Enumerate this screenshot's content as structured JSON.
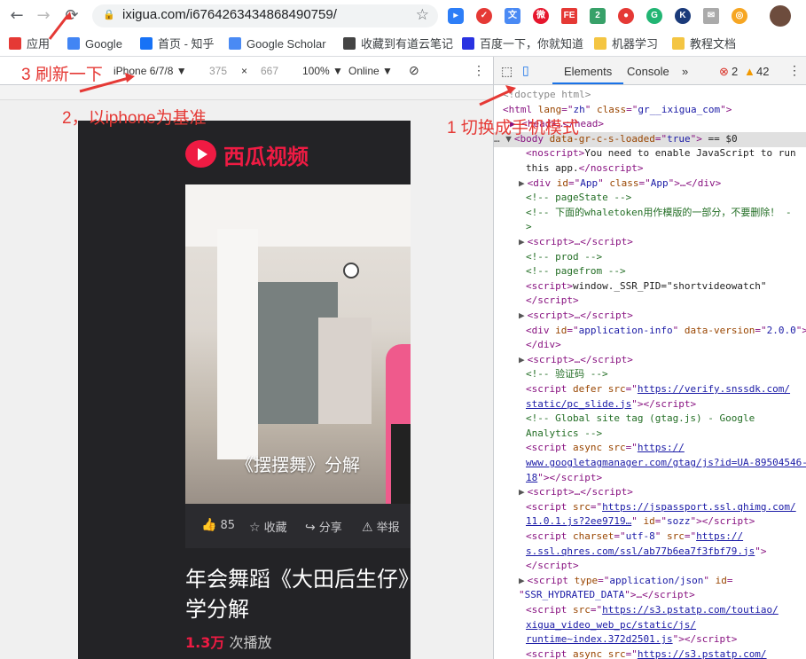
{
  "browser": {
    "url": "ixigua.com/i6764263434868490759/",
    "lock_icon": "lock-icon",
    "star_icon": "star-icon"
  },
  "bookmarks": [
    {
      "label": "应用",
      "color": "#e53935"
    },
    {
      "label": "Google",
      "color": "#4285f4"
    },
    {
      "label": "首页 - 知乎",
      "color": "#1772f6"
    },
    {
      "label": "Google Scholar",
      "color": "#4a8af4"
    },
    {
      "label": "收藏到有道云笔记",
      "color": "#444"
    },
    {
      "label": "百度一下，你就知道",
      "color": "#2932e1"
    },
    {
      "label": "机器学习",
      "color": "#f4c542"
    },
    {
      "label": "教程文档",
      "color": "#f4c542"
    }
  ],
  "devbar": {
    "device": "iPhone 6/7/8 ▼",
    "width": "375",
    "times": "×",
    "height": "667",
    "zoom": "100% ▼",
    "network": "Online ▼"
  },
  "devtools": {
    "tab_elements": "Elements",
    "tab_console": "Console",
    "more": "»",
    "errors": "2",
    "warnings": "42"
  },
  "page": {
    "logo_text": "西瓜视频",
    "video_caption": "《摆摆舞》分解",
    "like_count": "85",
    "collect": "收藏",
    "share": "分享",
    "report": "举报",
    "title": "年会舞蹈《大田后生仔》学分解",
    "views_number": "1.3万",
    "views_suffix": "次播放"
  },
  "annotations": {
    "step1": "1 切换成手机模式",
    "step2": "2，以iphone为基准",
    "step3": "3 刷新一下"
  },
  "dom_lines": [
    {
      "ind": 10,
      "html": "&lt;!doctype html&gt;",
      "cls": "gray"
    },
    {
      "ind": 10,
      "html": "&lt;html <span class='a'>lang</span>=\"<span class='v'>zh</span>\" <span class='a'>class</span>=\"<span class='v'>gr__ixigua_com</span>\"&gt;"
    },
    {
      "ind": 18,
      "html": "▶ &lt;head&gt;…&lt;/head&gt;"
    },
    {
      "ind": 0,
      "html": "<span class='tri'>… ▼</span>&lt;body <span class='a'>data-gr-c-s-loaded</span>=\"<span class='v'>true</span>\"&gt; <span class='t'>== $0</span>"
    },
    {
      "ind": 36,
      "html": "&lt;noscript&gt;<span class='t'>You need to enable JavaScript to run</span>"
    },
    {
      "ind": 36,
      "html": "<span class='t'>this app.</span>&lt;/noscript&gt;"
    },
    {
      "ind": 28,
      "html": "<span class='tri'>▶</span>&lt;div <span class='a'>id</span>=\"<span class='v'>App</span>\" <span class='a'>class</span>=\"<span class='v'>App</span>\"&gt;…&lt;/div&gt;"
    },
    {
      "ind": 36,
      "html": "<span class='c'>&lt;!-- pageState --&gt;</span>"
    },
    {
      "ind": 36,
      "html": "<span class='c'>&lt;!-- 下面的whaletoken用作模版的一部分，不要删除！ -</span>"
    },
    {
      "ind": 36,
      "html": "<span class='c'>&gt;</span>"
    },
    {
      "ind": 28,
      "html": "<span class='tri'>▶</span>&lt;script&gt;…&lt;/script&gt;"
    },
    {
      "ind": 36,
      "html": "<span class='c'>&lt;!-- prod --&gt;</span>"
    },
    {
      "ind": 36,
      "html": "<span class='c'>&lt;!-- pagefrom --&gt;</span>"
    },
    {
      "ind": 36,
      "html": "&lt;script&gt;<span class='t'>window._SSR_PID=\"shortvideowatch\"</span>"
    },
    {
      "ind": 36,
      "html": "&lt;/script&gt;"
    },
    {
      "ind": 28,
      "html": "<span class='tri'>▶</span>&lt;script&gt;…&lt;/script&gt;"
    },
    {
      "ind": 36,
      "html": "&lt;div <span class='a'>id</span>=\"<span class='v'>application-info</span>\" <span class='a'>data-version</span>=\"<span class='v'>2.0.0</span>\"&gt;"
    },
    {
      "ind": 36,
      "html": "&lt;/div&gt;"
    },
    {
      "ind": 28,
      "html": "<span class='tri'>▶</span>&lt;script&gt;…&lt;/script&gt;"
    },
    {
      "ind": 36,
      "html": "<span class='c'>&lt;!-- 验证码 --&gt;</span>"
    },
    {
      "ind": 36,
      "html": "&lt;script <span class='a'>defer</span> <span class='a'>src</span>=\"<span class='u'>https://verify.snssdk.com/</span>"
    },
    {
      "ind": 36,
      "html": "<span class='u'>static/pc_slide.js</span>\"&gt;&lt;/script&gt;"
    },
    {
      "ind": 36,
      "html": "<span class='c'>&lt;!-- Global site tag (gtag.js) - Google</span>"
    },
    {
      "ind": 36,
      "html": "<span class='c'>Analytics --&gt;</span>"
    },
    {
      "ind": 36,
      "html": "&lt;script <span class='a'>async</span> <span class='a'>src</span>=\"<span class='u'>https://</span>"
    },
    {
      "ind": 36,
      "html": "<span class='u'>www.googletagmanager.com/gtag/js?id=UA-89504546-</span>"
    },
    {
      "ind": 36,
      "html": "<span class='u'>18</span>\"&gt;&lt;/script&gt;"
    },
    {
      "ind": 28,
      "html": "<span class='tri'>▶</span>&lt;script&gt;…&lt;/script&gt;"
    },
    {
      "ind": 36,
      "html": "&lt;script <span class='a'>src</span>=\"<span class='u'>https://jspassport.ssl.qhimg.com/</span>"
    },
    {
      "ind": 36,
      "html": "<span class='u'>11.0.1.js?2ee9719…</span>\" <span class='a'>id</span>=\"<span class='v'>sozz</span>\"&gt;&lt;/script&gt;"
    },
    {
      "ind": 36,
      "html": "&lt;script <span class='a'>charset</span>=\"<span class='v'>utf-8</span>\" <span class='a'>src</span>=\"<span class='u'>https://</span>"
    },
    {
      "ind": 36,
      "html": "<span class='u'>s.ssl.qhres.com/ssl/ab77b6ea7f3fbf79.js</span>\"&gt;"
    },
    {
      "ind": 36,
      "html": "&lt;/script&gt;"
    },
    {
      "ind": 28,
      "html": "<span class='tri'>▶</span>&lt;script <span class='a'>type</span>=\"<span class='v'>application/json</span>\" <span class='a'>id</span>="
    },
    {
      "ind": 28,
      "html": "\"<span class='v'>SSR_HYDRATED_DATA</span>\"&gt;…&lt;/script&gt;"
    },
    {
      "ind": 36,
      "html": "&lt;script <span class='a'>src</span>=\"<span class='u'>https://s3.pstatp.com/toutiao/</span>"
    },
    {
      "ind": 36,
      "html": "<span class='u'>xigua_video_web_pc/static/js/</span>"
    },
    {
      "ind": 36,
      "html": "<span class='u'>runtime~index.372d2501.js</span>\"&gt;&lt;/script&gt;"
    },
    {
      "ind": 36,
      "html": "&lt;script <span class='a'>async</span> <span class='a'>src</span>=\"<span class='u'>https://s3.pstatp.com/</span>"
    }
  ]
}
